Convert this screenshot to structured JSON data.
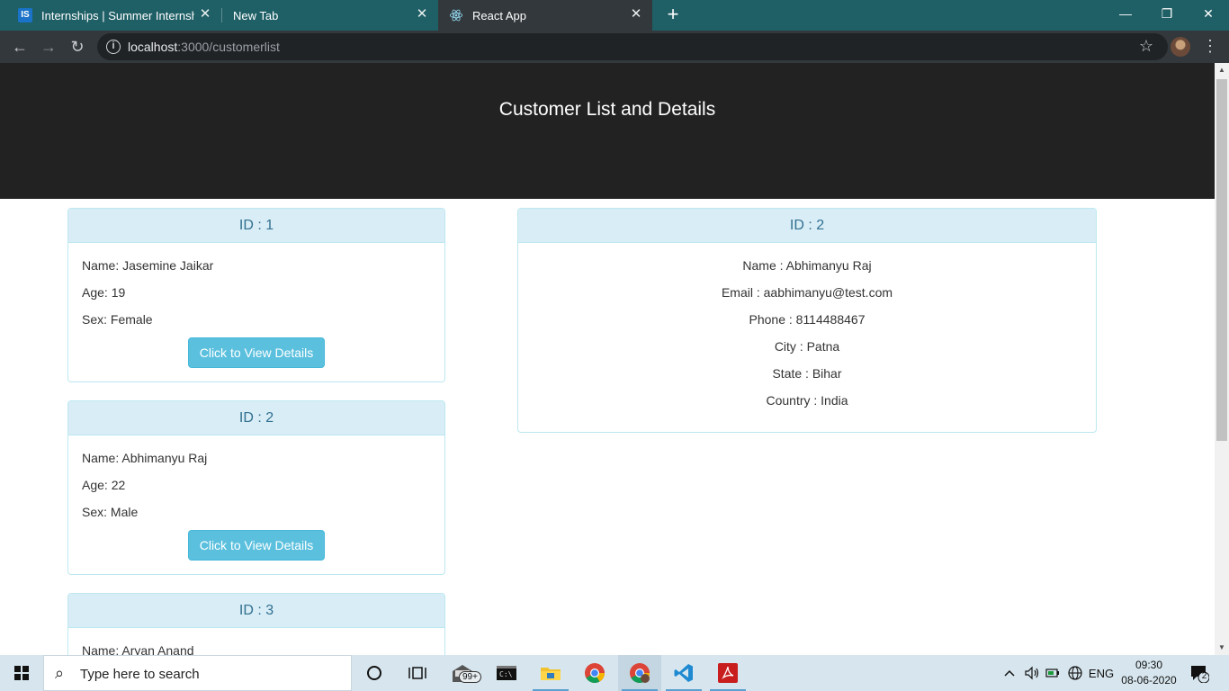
{
  "browser": {
    "tabs": [
      {
        "title": "Internships | Summer Internship",
        "favicon": "internshala-icon",
        "active": false
      },
      {
        "title": "New Tab",
        "favicon": "none",
        "active": false
      },
      {
        "title": "React App",
        "favicon": "react-icon",
        "active": true
      }
    ],
    "close_glyph": "✕",
    "new_tab_glyph": "+",
    "url_host": "localhost",
    "url_rest": ":3000/customerlist",
    "window_controls": {
      "minimize": "—",
      "restore": "❐",
      "close": "✕"
    }
  },
  "page": {
    "title": "Customer List and Details",
    "customers": [
      {
        "id_label": "ID : 1",
        "name": "Name: Jasemine Jaikar",
        "age": "Age: 19",
        "sex": "Sex: Female",
        "button": "Click to View Details"
      },
      {
        "id_label": "ID : 2",
        "name": "Name: Abhimanyu Raj",
        "age": "Age: 22",
        "sex": "Sex: Male",
        "button": "Click to View Details"
      },
      {
        "id_label": "ID : 3",
        "name": "Name: Aryan Anand"
      }
    ],
    "details": {
      "id_label": "ID : 2",
      "name": "Name : Abhimanyu Raj",
      "email": "Email : aabhimanyu@test.com",
      "phone": "Phone : 8114488467",
      "city": "City : Patna",
      "state": "State : Bihar",
      "country": "Country : India"
    }
  },
  "taskbar": {
    "search_placeholder": "Type here to search",
    "mail_badge": "99+",
    "language": "ENG",
    "time": "09:30",
    "date": "08-06-2020",
    "notification_count": "2"
  },
  "colors": {
    "tab_strip": "#1f5f66",
    "toolbar": "#33383c",
    "hero": "#222222",
    "panel_heading_bg": "#d9edf7",
    "panel_heading_text": "#31708f",
    "panel_border": "#bce8f1",
    "button_info": "#5bc0de",
    "taskbar": "#d7e6ee"
  }
}
